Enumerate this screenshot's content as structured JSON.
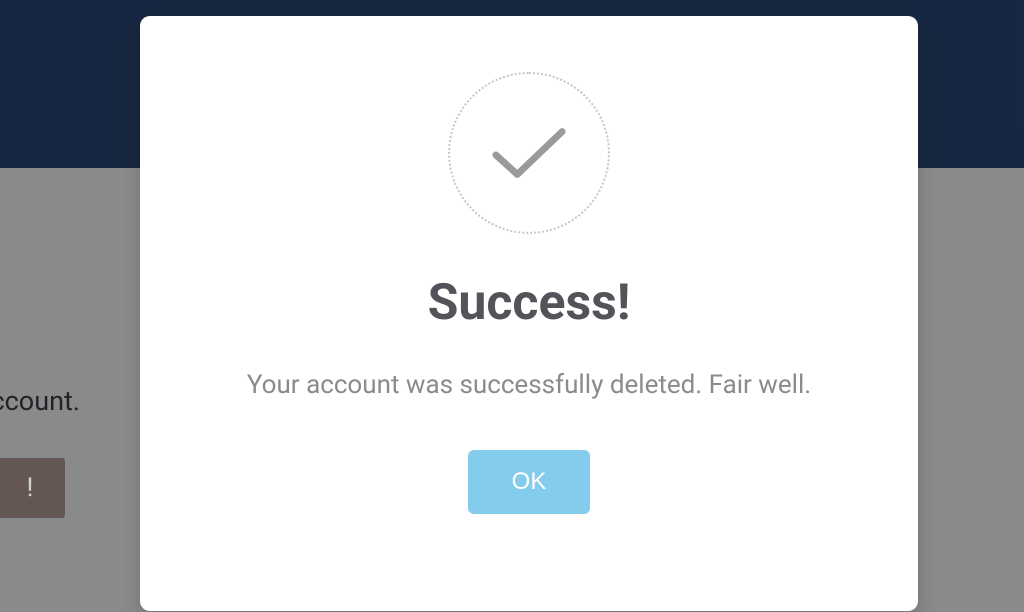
{
  "backdrop": {
    "partial_text": "r account.",
    "partial_button_label": "!"
  },
  "modal": {
    "title": "Success!",
    "message": "Your account was successfully deleted. Fair well.",
    "ok_label": "OK"
  },
  "icons": {
    "checkmark": "checkmark-icon"
  },
  "colors": {
    "header_blue": "#1e3050",
    "button_blue": "#84cceb",
    "title_gray": "#56525a",
    "message_gray": "#8b8b8d"
  }
}
